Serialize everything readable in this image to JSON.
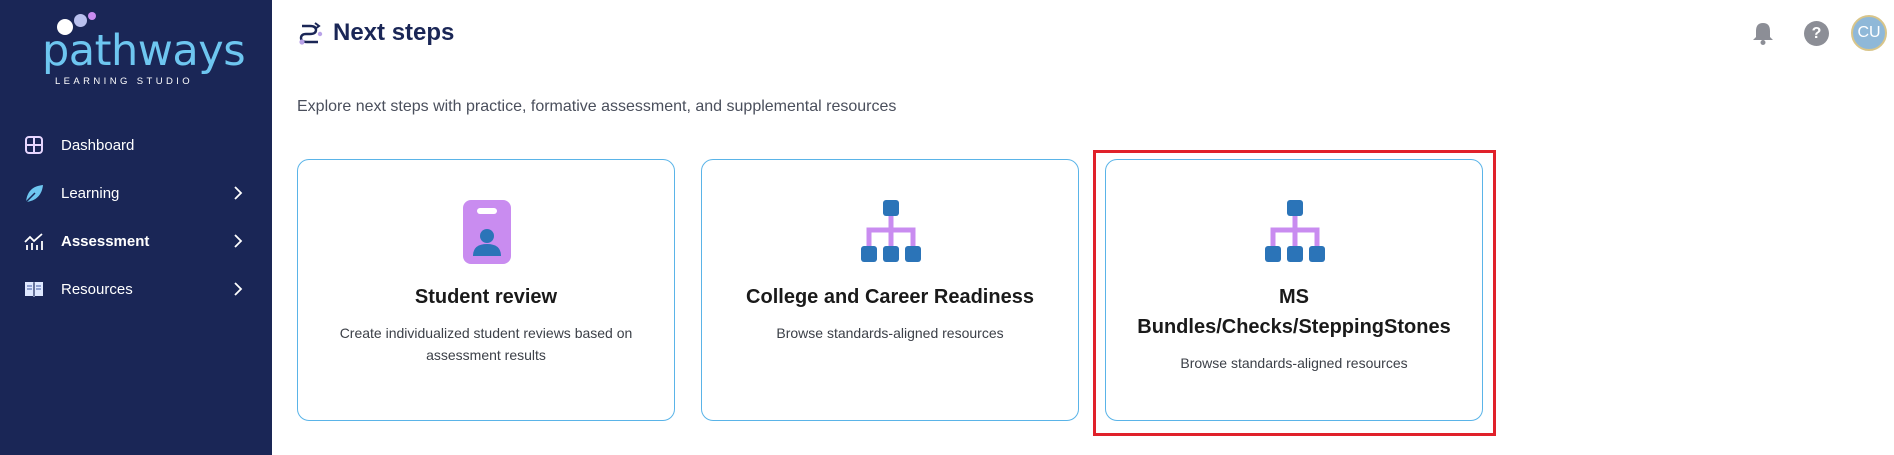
{
  "sidebar": {
    "logo": {
      "word": "pathways",
      "sub": "LEARNING STUDIO"
    },
    "items": [
      {
        "label": "Dashboard",
        "icon": "dashboard-grid-icon",
        "has_children": false
      },
      {
        "label": "Learning",
        "icon": "leaf-icon",
        "has_children": true
      },
      {
        "label": "Assessment",
        "icon": "chart-line-icon",
        "has_children": true,
        "active": true
      },
      {
        "label": "Resources",
        "icon": "book-icon",
        "has_children": true
      }
    ]
  },
  "header": {
    "title": "Next steps",
    "help_label": "?",
    "avatar_initials": "CU"
  },
  "main": {
    "subtitle": "Explore next steps with practice, formative assessment, and supplemental resources",
    "cards": [
      {
        "title": "Student review",
        "description": "Create individualized student reviews based on assessment results",
        "icon": "student-badge-icon"
      },
      {
        "title": "College and Career Readiness",
        "description": "Browse standards-aligned resources",
        "icon": "hierarchy-icon"
      },
      {
        "title_line1": "MS",
        "title_line2": "Bundles/Checks/SteppingStones",
        "description": "Browse standards-aligned resources",
        "icon": "hierarchy-icon"
      }
    ]
  },
  "colors": {
    "sidebar_bg": "#1a2656",
    "accent_blue": "#5ab4e8",
    "icon_purple": "#c98cf0",
    "icon_blue": "#2b74b8",
    "highlight_red": "#e0212a"
  }
}
